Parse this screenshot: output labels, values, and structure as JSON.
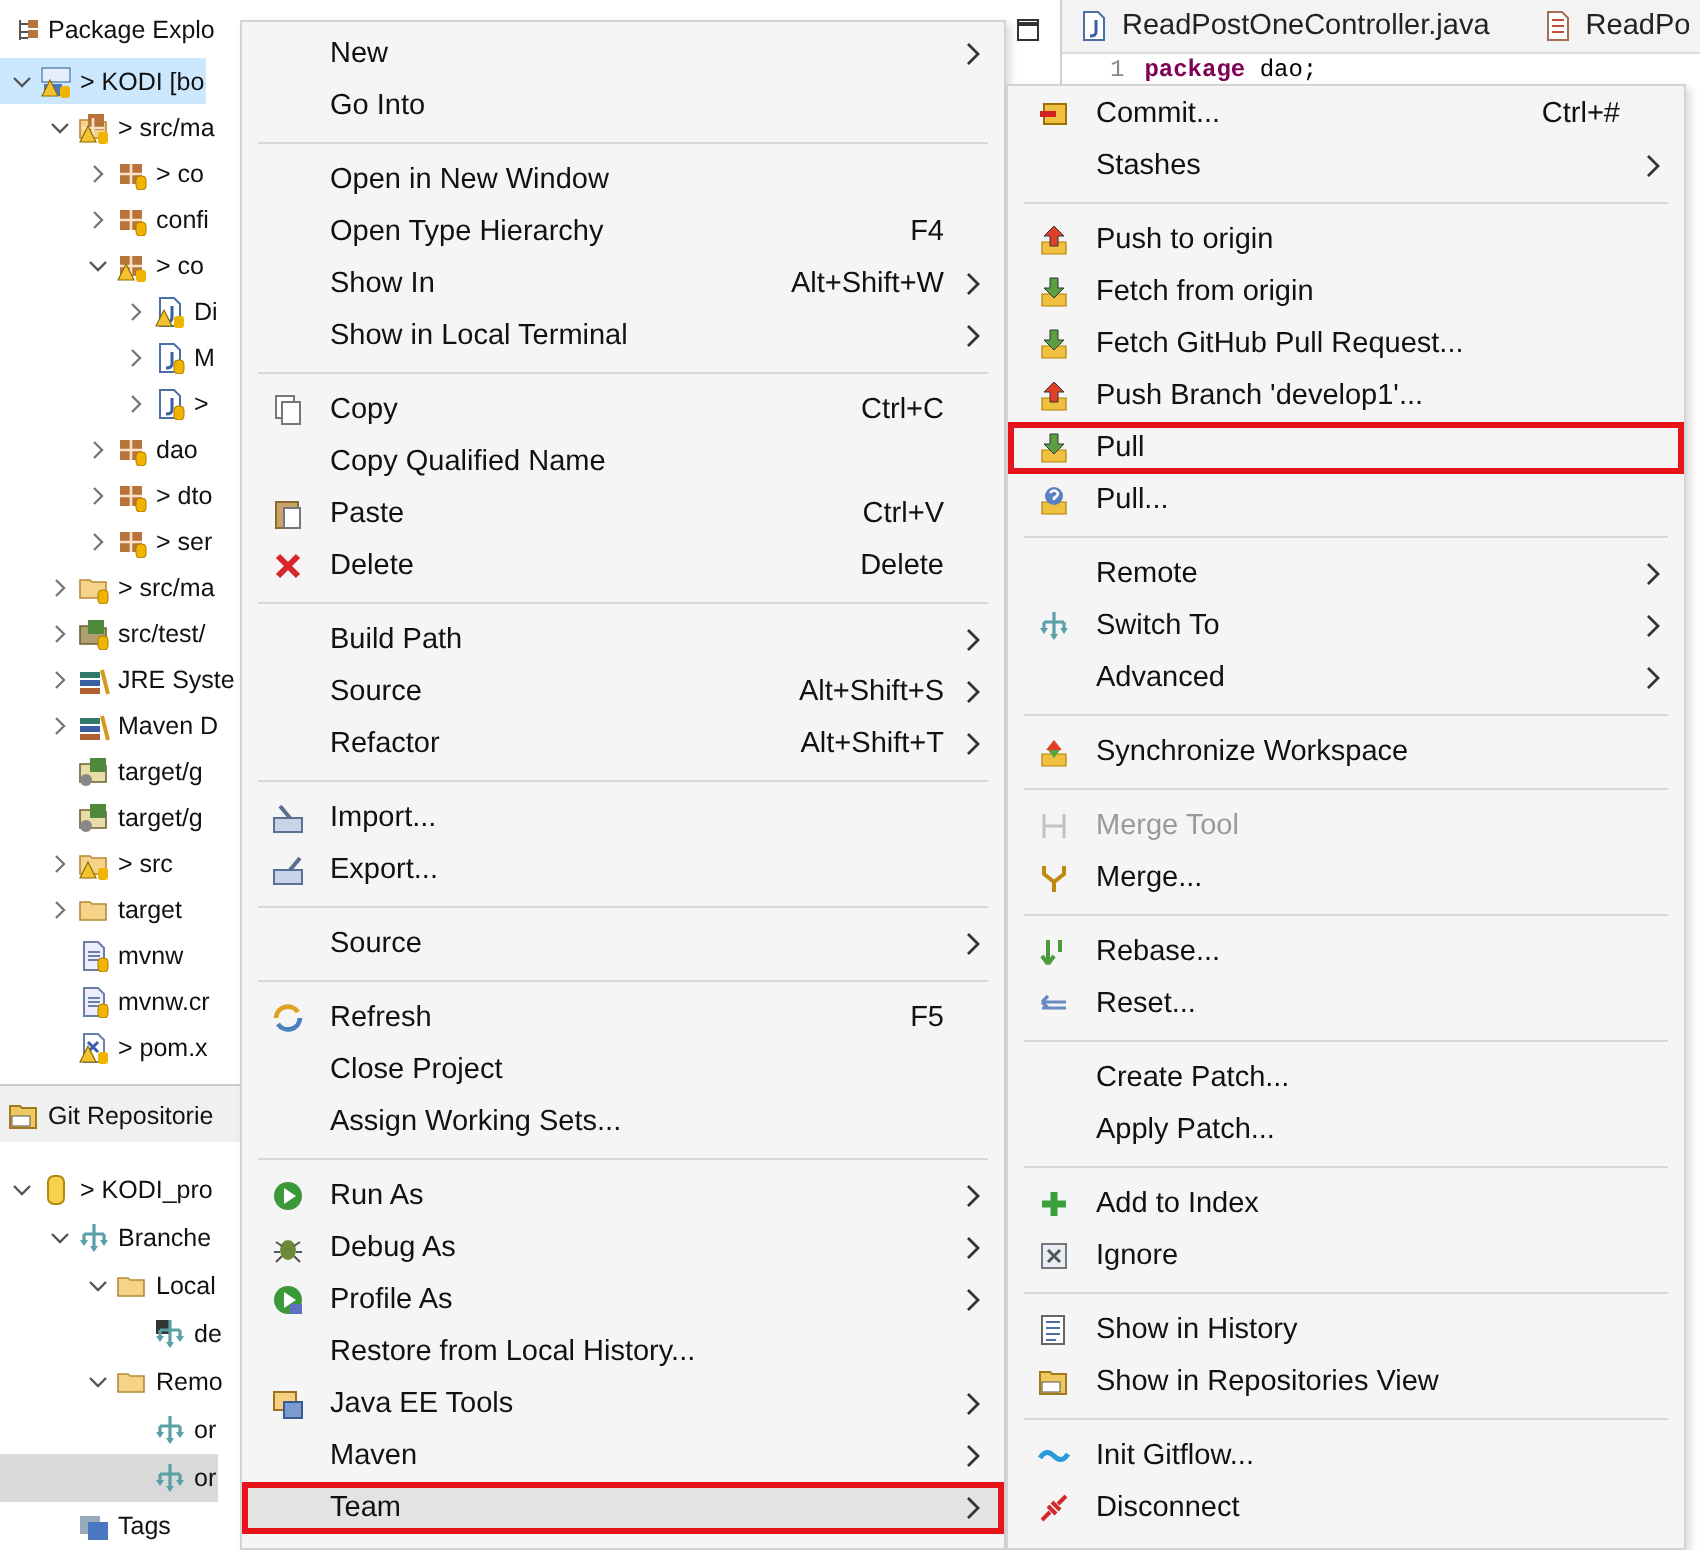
{
  "package_explorer": {
    "title": "Package Explo",
    "focused": true,
    "items": [
      {
        "label": "> KODI [bo",
        "kind": "project",
        "has_children": true,
        "expanded": true,
        "selected": true,
        "children": [
          {
            "label": "> src/ma",
            "kind": "source-folder-warn",
            "has_children": true,
            "expanded": true,
            "selected": false,
            "children": [
              {
                "label": "> co",
                "kind": "package",
                "has_children": true,
                "expanded": false,
                "selected": false
              },
              {
                "label": "confi",
                "kind": "package",
                "has_children": true,
                "expanded": false,
                "selected": false
              },
              {
                "label": "> co",
                "kind": "package-warn",
                "has_children": true,
                "expanded": true,
                "selected": false,
                "children": [
                  {
                    "label": "Di",
                    "kind": "java-file-warn",
                    "has_children": true,
                    "expanded": false,
                    "selected": false
                  },
                  {
                    "label": "M",
                    "kind": "java-file",
                    "has_children": true,
                    "expanded": false,
                    "selected": false
                  },
                  {
                    "label": ">",
                    "kind": "java-file",
                    "has_children": true,
                    "expanded": false,
                    "selected": false
                  }
                ]
              },
              {
                "label": "dao",
                "kind": "package",
                "has_children": true,
                "expanded": false,
                "selected": false
              },
              {
                "label": "> dto",
                "kind": "package",
                "has_children": true,
                "expanded": false,
                "selected": false
              },
              {
                "label": "> ser",
                "kind": "package",
                "has_children": true,
                "expanded": false,
                "selected": false
              }
            ]
          },
          {
            "label": "> src/ma",
            "kind": "source-folder",
            "has_children": true,
            "expanded": false,
            "selected": false
          },
          {
            "label": "src/test/",
            "kind": "source-folder-dark",
            "has_children": true,
            "expanded": false,
            "selected": false
          },
          {
            "label": "JRE Syste",
            "kind": "library",
            "has_children": true,
            "expanded": false,
            "selected": false
          },
          {
            "label": "Maven D",
            "kind": "library",
            "has_children": true,
            "expanded": false,
            "selected": false
          },
          {
            "label": "target/g",
            "kind": "source-folder-gen",
            "has_children": false,
            "selected": false
          },
          {
            "label": "target/g",
            "kind": "source-folder-gen",
            "has_children": false,
            "selected": false
          },
          {
            "label": "> src",
            "kind": "folder-warn",
            "has_children": true,
            "expanded": false,
            "selected": false
          },
          {
            "label": "target",
            "kind": "folder",
            "has_children": true,
            "expanded": false,
            "selected": false
          },
          {
            "label": "mvnw",
            "kind": "file",
            "has_children": false,
            "selected": false
          },
          {
            "label": "mvnw.cr",
            "kind": "file",
            "has_children": false,
            "selected": false
          },
          {
            "label": "> pom.x",
            "kind": "xml-warn",
            "has_children": false,
            "selected": false
          }
        ]
      }
    ]
  },
  "git_repositories": {
    "title": "Git Repositorie",
    "focused": false,
    "items": [
      {
        "label": "> KODI_pro",
        "kind": "repository",
        "has_children": true,
        "expanded": true,
        "selected": false,
        "children": [
          {
            "label": "Branche",
            "kind": "branches",
            "has_children": true,
            "expanded": true,
            "selected": false,
            "children": [
              {
                "label": "Local",
                "kind": "folder",
                "has_children": true,
                "expanded": true,
                "selected": false,
                "children": [
                  {
                    "label": "de",
                    "kind": "branch-checked",
                    "has_children": false,
                    "selected": false
                  }
                ]
              },
              {
                "label": "Remo",
                "kind": "folder",
                "has_children": true,
                "expanded": true,
                "selected": false,
                "children": [
                  {
                    "label": "or",
                    "kind": "branch",
                    "has_children": false,
                    "selected": false
                  },
                  {
                    "label": "or",
                    "kind": "branch",
                    "has_children": false,
                    "selected": true
                  }
                ]
              }
            ]
          },
          {
            "label": "Tags",
            "kind": "tags",
            "has_children": false,
            "selected": false
          }
        ]
      }
    ]
  },
  "editor": {
    "tabs": [
      {
        "label": "ReadPostOneController.java",
        "kind": "java"
      },
      {
        "label": "ReadPo",
        "kind": "xml"
      }
    ],
    "lines": [
      {
        "number": "1",
        "code": "**package** dao;"
      }
    ]
  },
  "context_menu": {
    "items": [
      {
        "kind": "item",
        "label": "New",
        "submenu": true,
        "selected": false,
        "framed": false
      },
      {
        "kind": "item",
        "label": "Go Into",
        "submenu": false,
        "selected": false,
        "framed": false
      },
      {
        "kind": "separator"
      },
      {
        "kind": "item",
        "label": "Open in New Window",
        "submenu": false,
        "selected": false,
        "framed": false
      },
      {
        "kind": "item",
        "label": "Open Type Hierarchy",
        "shortcut": "F4",
        "submenu": false,
        "selected": false,
        "framed": false
      },
      {
        "kind": "item",
        "label": "Show In",
        "shortcut": "Alt+Shift+W",
        "submenu": true,
        "selected": false,
        "framed": false
      },
      {
        "kind": "item",
        "label": "Show in Local Terminal",
        "submenu": true,
        "selected": false,
        "framed": false
      },
      {
        "kind": "separator"
      },
      {
        "kind": "item",
        "label": "Copy",
        "shortcut": "Ctrl+C",
        "submenu": false,
        "selected": false,
        "framed": false
      },
      {
        "kind": "item",
        "label": "Copy Qualified Name",
        "submenu": false,
        "selected": false,
        "framed": false
      },
      {
        "kind": "item",
        "label": "Paste",
        "shortcut": "Ctrl+V",
        "submenu": false,
        "selected": false,
        "framed": false
      },
      {
        "kind": "item",
        "label": "Delete",
        "shortcut": "Delete",
        "submenu": false,
        "selected": false,
        "framed": false
      },
      {
        "kind": "separator"
      },
      {
        "kind": "item",
        "label": "Build Path",
        "submenu": true,
        "selected": false,
        "framed": false
      },
      {
        "kind": "item",
        "label": "Source",
        "shortcut": "Alt+Shift+S",
        "submenu": true,
        "selected": false,
        "framed": false
      },
      {
        "kind": "item",
        "label": "Refactor",
        "shortcut": "Alt+Shift+T",
        "submenu": true,
        "selected": false,
        "framed": false
      },
      {
        "kind": "separator"
      },
      {
        "kind": "item",
        "label": "Import...",
        "submenu": false,
        "selected": false,
        "framed": false
      },
      {
        "kind": "item",
        "label": "Export...",
        "submenu": false,
        "selected": false,
        "framed": false
      },
      {
        "kind": "separator"
      },
      {
        "kind": "item",
        "label": "Source",
        "submenu": true,
        "selected": false,
        "framed": false
      },
      {
        "kind": "separator"
      },
      {
        "kind": "item",
        "label": "Refresh",
        "shortcut": "F5",
        "submenu": false,
        "selected": false,
        "framed": false
      },
      {
        "kind": "item",
        "label": "Close Project",
        "submenu": false,
        "selected": false,
        "framed": false
      },
      {
        "kind": "item",
        "label": "Assign Working Sets...",
        "submenu": false,
        "selected": false,
        "framed": false
      },
      {
        "kind": "separator"
      },
      {
        "kind": "item",
        "label": "Run As",
        "submenu": true,
        "selected": false,
        "framed": false
      },
      {
        "kind": "item",
        "label": "Debug As",
        "submenu": true,
        "selected": false,
        "framed": false
      },
      {
        "kind": "item",
        "label": "Profile As",
        "submenu": true,
        "selected": false,
        "framed": false
      },
      {
        "kind": "item",
        "label": "Restore from Local History...",
        "submenu": false,
        "selected": false,
        "framed": false
      },
      {
        "kind": "item",
        "label": "Java EE Tools",
        "submenu": true,
        "selected": false,
        "framed": false
      },
      {
        "kind": "item",
        "label": "Maven",
        "submenu": true,
        "selected": false,
        "framed": false
      },
      {
        "kind": "item",
        "label": "Team",
        "submenu": true,
        "selected": true,
        "framed": true
      }
    ]
  },
  "team_submenu": {
    "items": [
      {
        "kind": "item",
        "label": "Commit...",
        "shortcut": "Ctrl+#",
        "submenu": false,
        "disabled": false,
        "framed": false
      },
      {
        "kind": "item",
        "label": "Stashes",
        "submenu": true,
        "disabled": false,
        "framed": false
      },
      {
        "kind": "separator"
      },
      {
        "kind": "item",
        "label": "Push to origin",
        "submenu": false,
        "disabled": false,
        "framed": false
      },
      {
        "kind": "item",
        "label": "Fetch from origin",
        "submenu": false,
        "disabled": false,
        "framed": false
      },
      {
        "kind": "item",
        "label": "Fetch GitHub Pull Request...",
        "submenu": false,
        "disabled": false,
        "framed": false
      },
      {
        "kind": "item",
        "label": "Push Branch 'develop1'...",
        "submenu": false,
        "disabled": false,
        "framed": false
      },
      {
        "kind": "item",
        "label": "Pull",
        "submenu": false,
        "disabled": false,
        "framed": true
      },
      {
        "kind": "item",
        "label": "Pull...",
        "submenu": false,
        "disabled": false,
        "framed": false
      },
      {
        "kind": "separator"
      },
      {
        "kind": "item",
        "label": "Remote",
        "submenu": true,
        "disabled": false,
        "framed": false
      },
      {
        "kind": "item",
        "label": "Switch To",
        "submenu": true,
        "disabled": false,
        "framed": false
      },
      {
        "kind": "item",
        "label": "Advanced",
        "submenu": true,
        "disabled": false,
        "framed": false
      },
      {
        "kind": "separator"
      },
      {
        "kind": "item",
        "label": "Synchronize Workspace",
        "submenu": false,
        "disabled": false,
        "framed": false
      },
      {
        "kind": "separator"
      },
      {
        "kind": "item",
        "label": "Merge Tool",
        "submenu": false,
        "disabled": true,
        "framed": false
      },
      {
        "kind": "item",
        "label": "Merge...",
        "submenu": false,
        "disabled": false,
        "framed": false
      },
      {
        "kind": "separator"
      },
      {
        "kind": "item",
        "label": "Rebase...",
        "submenu": false,
        "disabled": false,
        "framed": false
      },
      {
        "kind": "item",
        "label": "Reset...",
        "submenu": false,
        "disabled": false,
        "framed": false
      },
      {
        "kind": "separator"
      },
      {
        "kind": "item",
        "label": "Create Patch...",
        "submenu": false,
        "disabled": false,
        "framed": false
      },
      {
        "kind": "item",
        "label": "Apply Patch...",
        "submenu": false,
        "disabled": false,
        "framed": false
      },
      {
        "kind": "separator"
      },
      {
        "kind": "item",
        "label": "Add to Index",
        "submenu": false,
        "disabled": false,
        "framed": false
      },
      {
        "kind": "item",
        "label": "Ignore",
        "submenu": false,
        "disabled": false,
        "framed": false
      },
      {
        "kind": "separator"
      },
      {
        "kind": "item",
        "label": "Show in History",
        "submenu": false,
        "disabled": false,
        "framed": false
      },
      {
        "kind": "item",
        "label": "Show in Repositories View",
        "submenu": false,
        "disabled": false,
        "framed": false
      },
      {
        "kind": "separator"
      },
      {
        "kind": "item",
        "label": "Init Gitflow...",
        "submenu": false,
        "disabled": false,
        "framed": false
      },
      {
        "kind": "item",
        "label": "Disconnect",
        "submenu": false,
        "disabled": false,
        "framed": false
      }
    ]
  }
}
